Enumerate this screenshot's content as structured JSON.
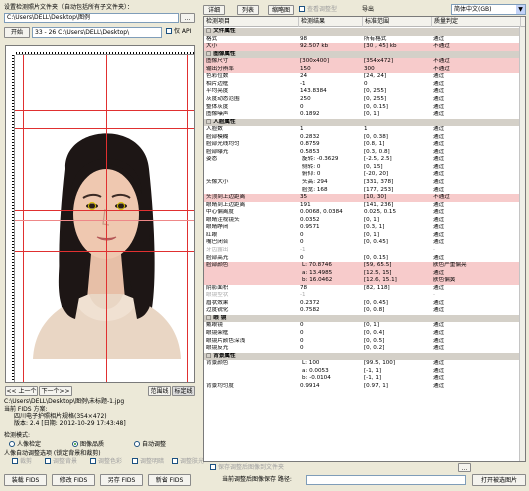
{
  "top": {
    "folder_label": "设置检测照片文件夹（自动包括所有子文件夹）：",
    "folder_path": "C:\\Users\\DELL\\Desktop\\图例",
    "browse_label": "...",
    "start_label": "开始",
    "progress_text": "33 - 26 C:\\Users\\DELL\\Desktop\\",
    "only_api_label": "仅 API"
  },
  "toolbar": {
    "detail_label": "详细",
    "list_label": "列表",
    "thumb_label": "缩略图",
    "view_adjust_label": "查看调整型",
    "export_label": "导出",
    "language": "简体中文(GB)"
  },
  "nav": {
    "prev_label": "<< 上一个",
    "next_label": "下一个>>",
    "range_label": "范围线",
    "mark_label": "标定线"
  },
  "file_info": {
    "current_label": "当前 FIDS 方案:",
    "path": "C:\\Users\\DELL\\Desktop\\图例\\未标题-1.jpg",
    "scheme_line1": "四川电子护照相片规格(354×472)",
    "scheme_line2": "版本: 2.4 [日期: 2012-10-29 17:43:48]"
  },
  "mode": {
    "label": "检测模式:",
    "options": [
      "人像检定",
      "图像品质",
      "自动调整"
    ],
    "selected": 1,
    "bg_label": "人像自动调整选项 (锁定背景和裁剪)",
    "checks": [
      "裁剪",
      "调整背景",
      "调整色彩",
      "调整明暗",
      "调整肤光"
    ]
  },
  "bottom_buttons": [
    "装载 FIDS",
    "修改 FIDS",
    "另存 FIDS",
    "新省 FIDS"
  ],
  "bottom_right": {
    "save_check_label": "保存调整后图像到文件夹",
    "path_label": "当前调整后图像保存 路径:",
    "open_label": "打开被选图片"
  },
  "table": {
    "headers": [
      "检测项目",
      "检测结果",
      "标准范围",
      "质量判定"
    ],
    "rows": [
      {
        "t": "sec",
        "c": [
          "□ 文件属性",
          "",
          "",
          ""
        ]
      },
      {
        "t": "",
        "c": [
          "格式",
          "98",
          "所有格式",
          "通过"
        ]
      },
      {
        "t": "red",
        "c": [
          "大小",
          "92.507 kb",
          "[30 , 45] kb",
          "不通过"
        ]
      },
      {
        "t": "sec",
        "c": [
          "□ 图像属性",
          "",
          "",
          ""
        ]
      },
      {
        "t": "red",
        "c": [
          "图像尺寸",
          "[300x400]",
          "[354x472]",
          "不通过"
        ]
      },
      {
        "t": "red",
        "c": [
          "输出分辨率",
          "150",
          "300",
          "不通过"
        ]
      },
      {
        "t": "",
        "c": [
          "色彩位数",
          "24",
          "[24, 24]",
          "通过"
        ]
      },
      {
        "t": "",
        "c": [
          "相片边框",
          "-1",
          "0",
          "通过"
        ]
      },
      {
        "t": "",
        "c": [
          "平均亮度",
          "143.8384",
          "[0, 255]",
          "通过"
        ]
      },
      {
        "t": "",
        "c": [
          "灰度动态范围",
          "250",
          "[0, 255]",
          "通过"
        ]
      },
      {
        "t": "",
        "c": [
          "整体灰度",
          "0",
          "[0, 0.15]",
          "通过"
        ]
      },
      {
        "t": "",
        "c": [
          "图像噪声",
          "0.1892",
          "[0, 1]",
          "通过"
        ]
      },
      {
        "t": "sec",
        "c": [
          "□ 人脸属性",
          "",
          "",
          ""
        ]
      },
      {
        "t": "",
        "c": [
          "人脸数",
          "1",
          "1",
          "通过"
        ]
      },
      {
        "t": "",
        "c": [
          "脸部模糊",
          "0.2832",
          "[0, 0.38]",
          "通过"
        ]
      },
      {
        "t": "",
        "c": [
          "脸部光线均匀",
          "0.8759",
          "[0.8, 1]",
          "通过"
        ]
      },
      {
        "t": "",
        "c": [
          "脸部曝光",
          "0.5853",
          "[0.3, 0.8]",
          "通过"
        ]
      },
      {
        "t": "",
        "c": [
          "姿态",
          "",
          "[-2.5, 2.5]",
          "通过"
        ],
        "s": "旋转: -0.3629"
      },
      {
        "t": "",
        "c": [
          "",
          "",
          "[0, 15]",
          "通过"
        ],
        "s": "侧转: 0"
      },
      {
        "t": "",
        "c": [
          "",
          "",
          "[-20, 20]",
          "通过"
        ],
        "s": "俯仰: 0"
      },
      {
        "t": "",
        "c": [
          "头像大小",
          "",
          "[331, 378]",
          "通过"
        ],
        "s": "头高: 294"
      },
      {
        "t": "",
        "c": [
          "",
          "",
          "[177, 253]",
          "通过"
        ],
        "s": "脸宽: 168"
      },
      {
        "t": "red",
        "c": [
          "头顶到上边距离",
          "35",
          "[10, 30]",
          "不通过"
        ]
      },
      {
        "t": "",
        "c": [
          "眼睛到上边距离",
          "191",
          "[141, 236]",
          "通过"
        ]
      },
      {
        "t": "",
        "c": [
          "中心偏离度",
          "0.0068, 0.0384",
          "0.025, 0.15",
          "通过"
        ]
      },
      {
        "t": "",
        "c": [
          "眼睛注视镜头",
          "0.0352",
          "[0, 1]",
          "通过"
        ]
      },
      {
        "t": "",
        "c": [
          "眼睛睁闭",
          "0.9571",
          "[0.3, 1]",
          "通过"
        ]
      },
      {
        "t": "",
        "c": [
          "红眼",
          "0",
          "[0, 1]",
          "通过"
        ]
      },
      {
        "t": "",
        "c": [
          "嘴巴闭合",
          "0",
          "[0, 0.45]",
          "通过"
        ]
      },
      {
        "t": "dim",
        "c": [
          "牙齿露出",
          "-1",
          "",
          "-"
        ]
      },
      {
        "t": "",
        "c": [
          "脸部高光",
          "0",
          "[0, 0.15]",
          "通过"
        ]
      },
      {
        "t": "red",
        "c": [
          "脸部颜色",
          "",
          "[59, 65.5]",
          "肤色严重偏亮"
        ],
        "s": "L: 70.8746"
      },
      {
        "t": "red",
        "c": [
          "",
          "",
          "[12.5, 15]",
          "通过"
        ],
        "s": "a: 13.4985"
      },
      {
        "t": "red",
        "c": [
          "",
          "",
          "[12.6, 15.1]",
          "肤色偏黄"
        ],
        "s": "b: 16.0462"
      },
      {
        "t": "",
        "c": [
          "阴影面积",
          "78",
          "[82, 118]",
          "通过"
        ]
      },
      {
        "t": "dim",
        "c": [
          "眼镜型状",
          "-1",
          "",
          "-"
        ]
      },
      {
        "t": "",
        "c": [
          "眉状效果",
          "0.2372",
          "[0, 0.45]",
          "通过"
        ]
      },
      {
        "t": "",
        "c": [
          "过度锐化",
          "0.7582",
          "[0, 0.8]",
          "通过"
        ]
      },
      {
        "t": "sec",
        "c": [
          "□ 眼   镜",
          "",
          "",
          ""
        ]
      },
      {
        "t": "",
        "c": [
          "戴眼镜",
          "0",
          "[0, 1]",
          "通过"
        ]
      },
      {
        "t": "",
        "c": [
          "眼镜架框",
          "0",
          "[0, 0.4]",
          "通过"
        ]
      },
      {
        "t": "",
        "c": [
          "眼镜片颜色深浅",
          "0",
          "[0, 0.5]",
          "通过"
        ]
      },
      {
        "t": "",
        "c": [
          "眼镜反光",
          "0",
          "[0, 0.2]",
          "通过"
        ]
      },
      {
        "t": "sec",
        "c": [
          "□ 背景属性",
          "",
          "",
          ""
        ]
      },
      {
        "t": "",
        "c": [
          "背景颜色",
          "",
          "[99.5, 100]",
          "通过"
        ],
        "s": "L: 100"
      },
      {
        "t": "",
        "c": [
          "",
          "",
          "[-1, 1]",
          "通过"
        ],
        "s": "a: 0.0053"
      },
      {
        "t": "",
        "c": [
          "",
          "",
          "[-1, 1]",
          "通过"
        ],
        "s": "b: -0.0104"
      },
      {
        "t": "",
        "c": [
          "背景均匀度",
          "0.9914",
          "[0.97, 1]",
          "通过"
        ]
      }
    ]
  }
}
